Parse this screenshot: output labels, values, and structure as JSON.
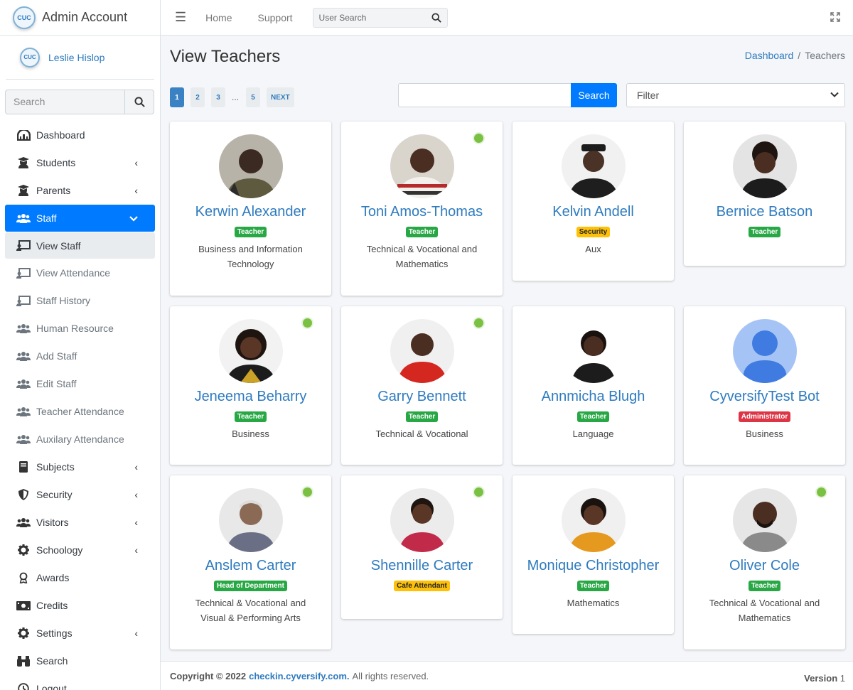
{
  "brand": {
    "title": "Admin Account",
    "logo_text": "CUC"
  },
  "user": {
    "name": "Leslie Hislop"
  },
  "sidebar": {
    "search_placeholder": "Search",
    "items": [
      {
        "label": "Dashboard",
        "icon": "dashboard-icon"
      },
      {
        "label": "Students",
        "icon": "graduate-icon"
      },
      {
        "label": "Parents",
        "icon": "graduate-icon"
      },
      {
        "label": "Staff",
        "icon": "users-icon"
      },
      {
        "label": "View Staff",
        "icon": "chalkboard-teacher-icon"
      },
      {
        "label": "View Attendance",
        "icon": "chalkboard-teacher-icon"
      },
      {
        "label": "Staff History",
        "icon": "chalkboard-teacher-icon"
      },
      {
        "label": "Human Resource",
        "icon": "users-icon"
      },
      {
        "label": "Add Staff",
        "icon": "users-icon"
      },
      {
        "label": "Edit Staff",
        "icon": "users-icon"
      },
      {
        "label": "Teacher Attendance",
        "icon": "users-icon"
      },
      {
        "label": "Auxilary Attendance",
        "icon": "users-icon"
      },
      {
        "label": "Subjects",
        "icon": "book-icon"
      },
      {
        "label": "Security",
        "icon": "shield-icon"
      },
      {
        "label": "Visitors",
        "icon": "users-icon"
      },
      {
        "label": "Schoology",
        "icon": "gear-icon"
      },
      {
        "label": "Awards",
        "icon": "award-icon"
      },
      {
        "label": "Credits",
        "icon": "money-icon"
      },
      {
        "label": "Settings",
        "icon": "gear-icon"
      },
      {
        "label": "Search",
        "icon": "binoculars-icon"
      },
      {
        "label": "Logout",
        "icon": "clock-icon"
      }
    ]
  },
  "topbar": {
    "home": "Home",
    "support": "Support",
    "search_placeholder": "User Search"
  },
  "page": {
    "title": "View Teachers"
  },
  "breadcrumb": {
    "dashboard": "Dashboard",
    "separator": "/",
    "current": "Teachers"
  },
  "pagination": {
    "p1": "1",
    "p2": "2",
    "p3": "3",
    "dots": "...",
    "p5": "5",
    "next": "NEXT"
  },
  "search": {
    "button": "Search",
    "filter": "Filter"
  },
  "teachers": [
    {
      "name": "Kerwin Alexander",
      "role": "Teacher",
      "dept": "Business and Information Technology"
    },
    {
      "name": "Toni Amos-Thomas",
      "role": "Teacher",
      "dept": "Technical & Vocational and Mathematics"
    },
    {
      "name": "Kelvin Andell",
      "role": "Security",
      "dept": "Aux"
    },
    {
      "name": "Bernice Batson",
      "role": "Teacher",
      "dept": ""
    },
    {
      "name": "Jeneema Beharry",
      "role": "Teacher",
      "dept": "Business"
    },
    {
      "name": "Garry Bennett",
      "role": "Teacher",
      "dept": "Technical & Vocational"
    },
    {
      "name": "Annmicha Blugh",
      "role": "Teacher",
      "dept": "Language"
    },
    {
      "name": "CyversifyTest Bot",
      "role": "Administrator",
      "dept": "Business"
    },
    {
      "name": "Anslem Carter",
      "role": "Head of Department",
      "dept": "Technical & Vocational and Visual & Performing Arts"
    },
    {
      "name": "Shennille Carter",
      "role": "Cafe Attendant",
      "dept": ""
    },
    {
      "name": "Monique Christopher",
      "role": "Teacher",
      "dept": "Mathematics"
    },
    {
      "name": "Oliver Cole",
      "role": "Teacher",
      "dept": "Technical & Vocational and Mathematics"
    }
  ],
  "footer": {
    "copyright": "Copyright © 2022",
    "link": "checkin.cyversify.com.",
    "rights": "All rights reserved.",
    "version_label": "Version",
    "version": "1"
  },
  "colors": {
    "primary": "#007bff",
    "link": "#2e7bbf",
    "online": "#7ac143",
    "badge_teacher": "#28a745",
    "badge_security": "#ffc107",
    "badge_admin": "#dc3545"
  }
}
